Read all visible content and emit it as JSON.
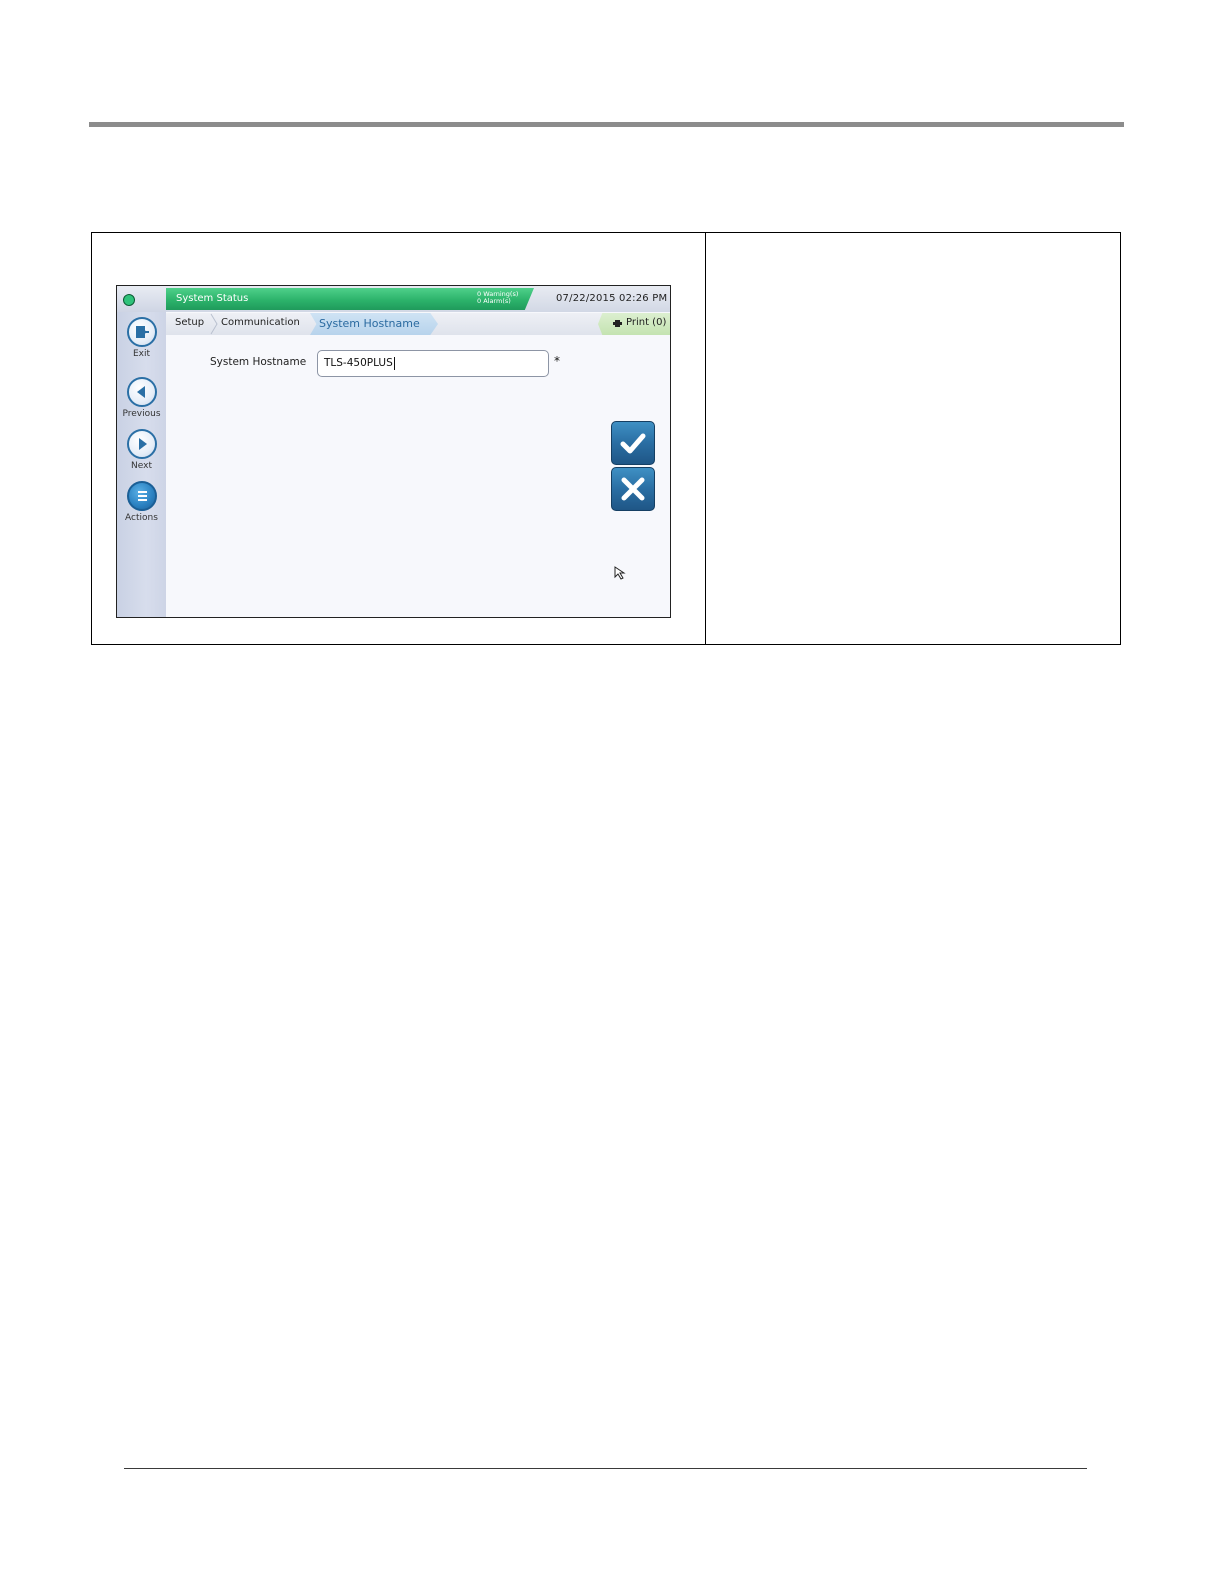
{
  "status_bar": {
    "title": "System Status",
    "warnings": "0 Warning(s)",
    "alarms": "0 Alarm(s)",
    "datetime": "07/22/2015 02:26 PM"
  },
  "breadcrumb": {
    "items": [
      "Setup",
      "Communication"
    ],
    "current": "System Hostname",
    "print_label": "Print (0)"
  },
  "sidebar": {
    "exit": "Exit",
    "previous": "Previous",
    "next": "Next",
    "actions": "Actions"
  },
  "form": {
    "hostname_label": "System Hostname",
    "hostname_value": "TLS-450PLUS",
    "required_marker": "*"
  },
  "colors": {
    "status_green": "#2cb36b",
    "accent_blue": "#2a6ea3"
  },
  "icons": {
    "exit": "exit-icon",
    "previous": "previous-arrow-icon",
    "next": "next-arrow-icon",
    "actions": "menu-lines-icon",
    "accept": "checkmark-icon",
    "cancel": "x-icon",
    "print": "printer-icon",
    "pointer": "mouse-pointer-icon"
  }
}
